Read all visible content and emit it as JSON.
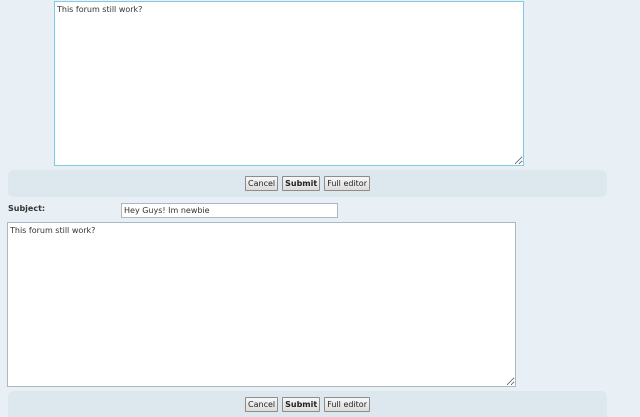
{
  "quick_reply_1": {
    "message": "This forum still work?",
    "buttons": {
      "cancel_label": "Cancel",
      "submit_label": "Submit",
      "full_editor_label": "Full editor"
    }
  },
  "quick_reply_2": {
    "subject_label": "Subject:",
    "subject_value": "Hey Guys! Im newbie",
    "message": "This forum still work?",
    "buttons": {
      "cancel_label": "Cancel",
      "submit_label": "Submit",
      "full_editor_label": "Full editor"
    }
  },
  "colors": {
    "page_background": "#e8f0f5",
    "button_bar": "#dde7ee",
    "focused_border": "#7ecbe3"
  }
}
